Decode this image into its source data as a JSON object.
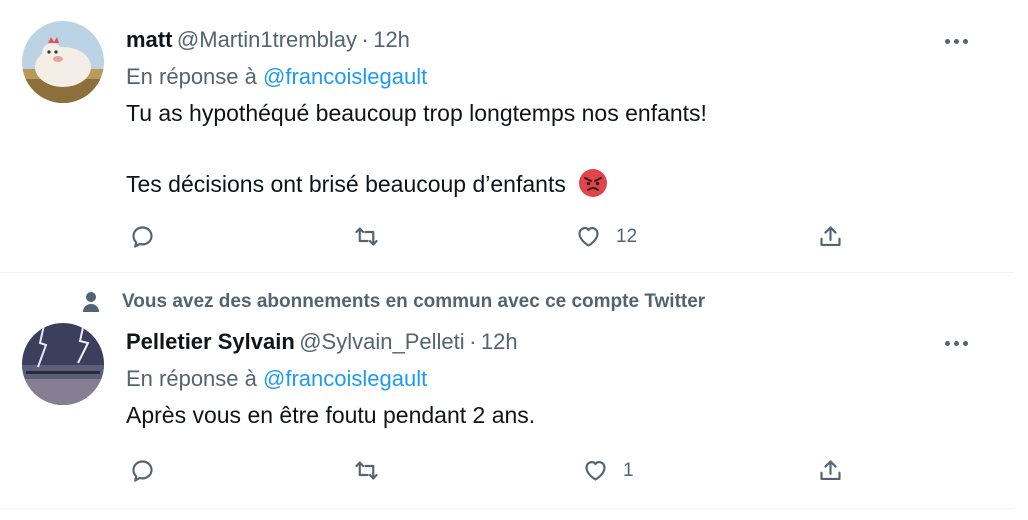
{
  "tweets": [
    {
      "name": "matt",
      "handle": "@Martin1tremblay",
      "separator": "·",
      "time": "12h",
      "reply_prefix": "En réponse à",
      "reply_handle": "@francoislegault",
      "line1": "Tu as hypothéqué beaucoup trop longtemps nos enfants!",
      "line2": "Tes décisions ont brisé beaucoup d’enfants",
      "line2_emoji": "angry-face-icon",
      "reply_count": "",
      "retweet_count": "",
      "like_count": "12"
    },
    {
      "social_context": "Vous avez des abonnements en commun avec ce compte Twitter",
      "name": "Pelletier Sylvain",
      "handle": "@Sylvain_Pelleti",
      "separator": "·",
      "time": "12h",
      "reply_prefix": "En réponse à",
      "reply_handle": "@francoislegault",
      "line1": "Après vous en être foutu pendant 2 ans.",
      "reply_count": "",
      "retweet_count": "",
      "like_count": "1"
    }
  ],
  "colors": {
    "link": "#1d9bf0",
    "secondary_text": "#536471",
    "primary_text": "#0f1419",
    "divider": "#eff3f4"
  }
}
